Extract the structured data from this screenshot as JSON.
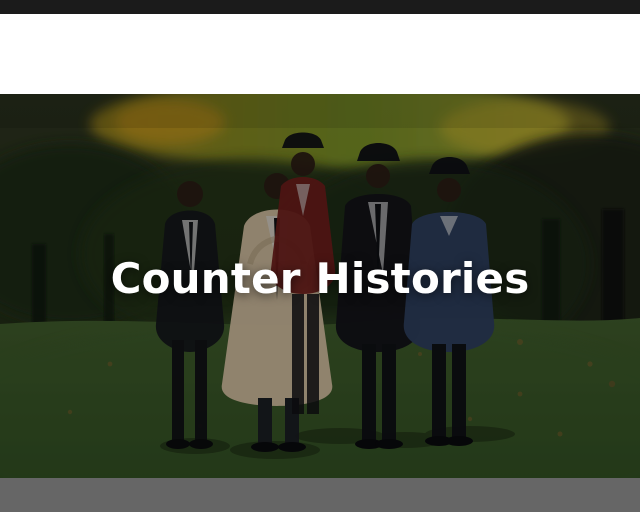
{
  "header": {
    "title": "Counter Histories"
  },
  "colors": {
    "top_strip": "#1b1b1b",
    "page_bg": "#ffffff",
    "bottom_bar": "#666666"
  },
  "image": {
    "semantic": "hero-photo"
  }
}
